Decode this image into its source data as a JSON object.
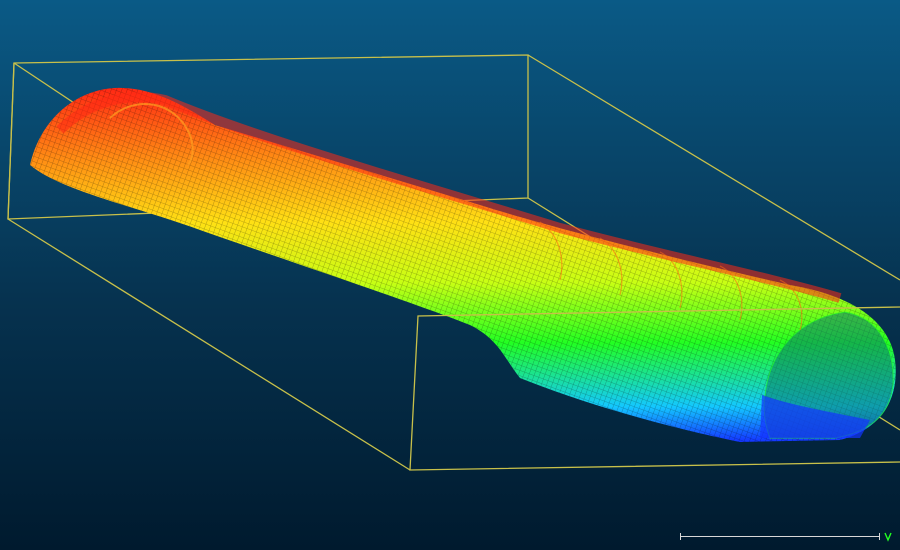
{
  "viewer": {
    "background_top": "#0a5a86",
    "background_bottom": "#001a2e",
    "bounding_box_color": "#c8c04a",
    "color_ramp": [
      "#1434ff",
      "#14c8ff",
      "#22ff22",
      "#c8ff14",
      "#ffe014",
      "#ff8c14",
      "#ff2814"
    ],
    "scalar_field": "height"
  },
  "scale_bar": {
    "line_color": "#d8d8d8",
    "axis_marker_color": "#22ff22"
  }
}
